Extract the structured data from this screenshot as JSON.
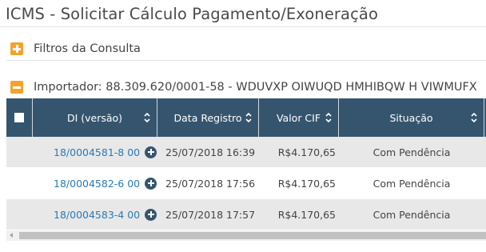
{
  "page": {
    "title": "ICMS - Solicitar Cálculo Pagamento/Exoneração"
  },
  "filters": {
    "label": "Filtros da Consulta",
    "icon": "plus-square-icon",
    "color": "#f3a32c"
  },
  "importer": {
    "label": "Importador: 88.309.620/0001-58 - WDUVXP OIWUQD HMHIBQW H VIWMUFX",
    "icon": "minus-square-icon",
    "color": "#f3a32c"
  },
  "table": {
    "header_bg": "#35556f",
    "columns": [
      "DI (versão)",
      "Data Registro",
      "Valor CIF",
      "Situação"
    ],
    "rows": [
      {
        "di": "18/0004581-8 00",
        "data": "25/07/2018 16:39",
        "valor": "R$4.170,65",
        "situacao": "Com Pendência"
      },
      {
        "di": "18/0004582-6 00",
        "data": "25/07/2018 17:56",
        "valor": "R$4.170,65",
        "situacao": "Com Pendência"
      },
      {
        "di": "18/0004583-4 00",
        "data": "25/07/2018 17:57",
        "valor": "R$4.170,65",
        "situacao": "Com Pendência"
      }
    ]
  }
}
